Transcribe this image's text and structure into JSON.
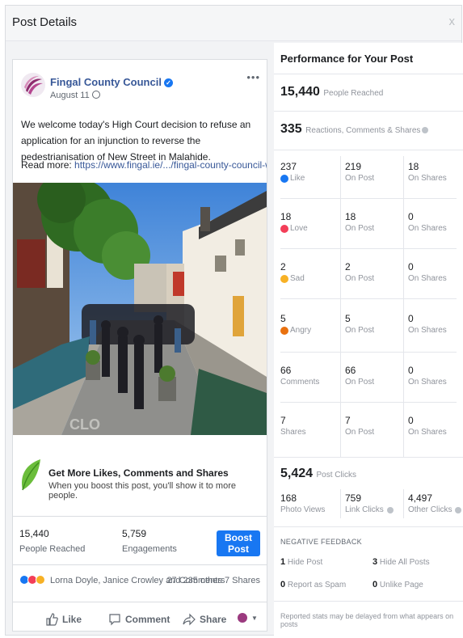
{
  "header": {
    "title": "Post Details",
    "close": "x"
  },
  "post": {
    "page_name": "Fingal County Council",
    "date": "August 11",
    "more": "•••",
    "text": "We welcome today's High Court decision to refuse an application for an injunction to reverse the pedestrianisation of New Street in Malahide.",
    "read_more_label": "Read more:",
    "read_more_link": "https://www.fingal.ie/.../fingal-county-council-welcomes-new-..."
  },
  "boost_banner": {
    "title": "Get More Likes, Comments and Shares",
    "subtitle": "When you boost this post, you'll show it to more people."
  },
  "summary": {
    "people_reached_value": "15,440",
    "people_reached_label": "People Reached",
    "engagements_value": "5,759",
    "engagements_label": "Engagements",
    "boost_button": "Boost Post"
  },
  "reactions_bar": {
    "names": "Lorna Doyle, Janice Crowley and 235 others",
    "counts": "27 Comments  7 Shares"
  },
  "actions": {
    "like": "Like",
    "comment": "Comment",
    "share": "Share"
  },
  "performance": {
    "title": "Performance for Your Post",
    "reached_value": "15,440",
    "reached_label": "People Reached",
    "rcs_value": "335",
    "rcs_label": "Reactions, Comments & Shares",
    "rows": [
      {
        "total": "237",
        "label": "Like",
        "icon": "like-icon",
        "on_post": "219",
        "on_shares": "18"
      },
      {
        "total": "18",
        "label": "Love",
        "icon": "love-icon",
        "on_post": "18",
        "on_shares": "0"
      },
      {
        "total": "2",
        "label": "Sad",
        "icon": "sad-icon",
        "on_post": "2",
        "on_shares": "0"
      },
      {
        "total": "5",
        "label": "Angry",
        "icon": "angry-icon",
        "on_post": "5",
        "on_shares": "0"
      },
      {
        "total": "66",
        "label": "Comments",
        "icon": "",
        "on_post": "66",
        "on_shares": "0"
      },
      {
        "total": "7",
        "label": "Shares",
        "icon": "",
        "on_post": "7",
        "on_shares": "0"
      }
    ],
    "on_post_label": "On Post",
    "on_shares_label": "On Shares",
    "clicks_value": "5,424",
    "clicks_label": "Post Clicks",
    "photo_views_value": "168",
    "photo_views_label": "Photo Views",
    "link_clicks_value": "759",
    "link_clicks_label": "Link Clicks",
    "other_clicks_value": "4,497",
    "other_clicks_label": "Other Clicks",
    "negative_title": "NEGATIVE FEEDBACK",
    "hide_post_value": "1",
    "hide_post_label": "Hide Post",
    "hide_all_value": "3",
    "hide_all_label": "Hide All Posts",
    "spam_value": "0",
    "spam_label": "Report as Spam",
    "unlike_value": "0",
    "unlike_label": "Unlike Page",
    "footer": "Reported stats may be delayed from what appears on posts"
  },
  "colors": {
    "brand_blue": "#1877f2",
    "link": "#385898",
    "like": "#1877f2",
    "love": "#f33e58",
    "sad": "#f7b125",
    "angry": "#e9710f"
  }
}
